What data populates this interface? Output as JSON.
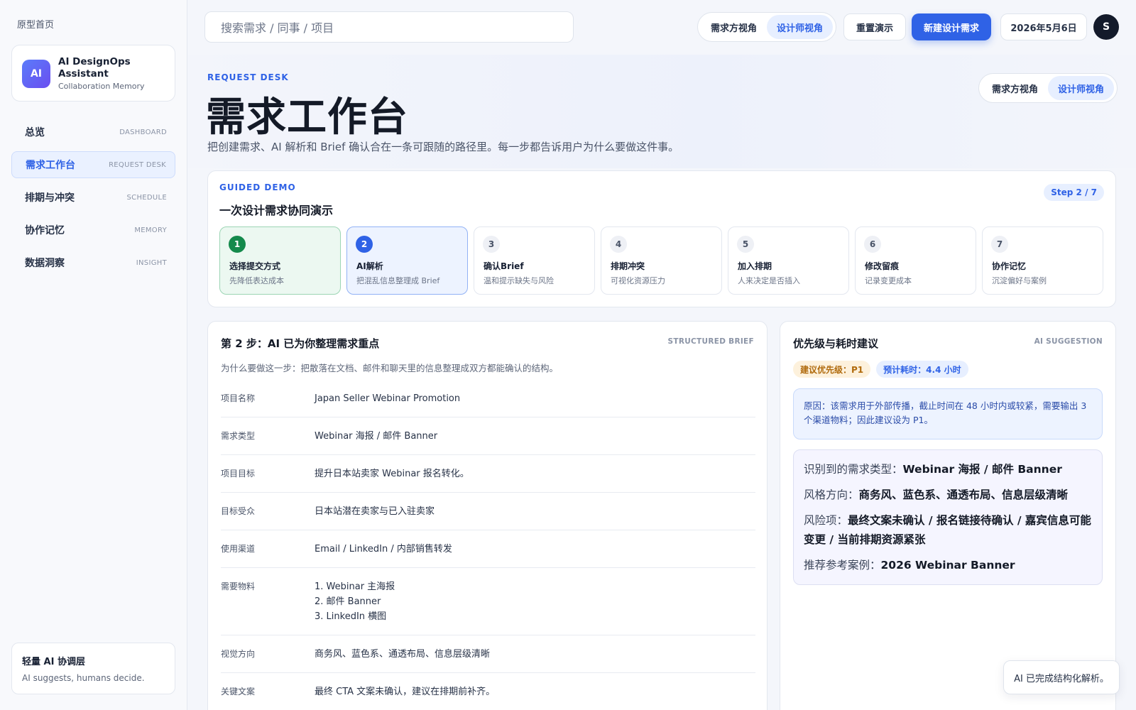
{
  "sidebar": {
    "home_link": "原型首页",
    "brand": {
      "logo": "AI",
      "title": "AI DesignOps Assistant",
      "subtitle": "Collaboration Memory"
    },
    "items": [
      {
        "label": "总览",
        "en": "DASHBOARD"
      },
      {
        "label": "需求工作台",
        "en": "REQUEST DESK"
      },
      {
        "label": "排期与冲突",
        "en": "SCHEDULE"
      },
      {
        "label": "协作记忆",
        "en": "MEMORY"
      },
      {
        "label": "数据洞察",
        "en": "INSIGHT"
      }
    ],
    "footer": {
      "title": "轻量 AI 协调层",
      "subtitle": "AI suggests, humans decide."
    }
  },
  "topbar": {
    "search_placeholder": "搜索需求 / 同事 / 项目",
    "view_toggle": [
      "需求方视角",
      "设计师视角"
    ],
    "reset_label": "重置演示",
    "new_request_label": "新建设计需求",
    "date": "2026年5月6日",
    "avatar": "S"
  },
  "header": {
    "eyebrow": "REQUEST DESK",
    "title": "需求工作台",
    "description": "把创建需求、AI 解析和 Brief 确认合在一条可跟随的路径里。每一步都告诉用户为什么要做这件事。",
    "view_toggle": [
      "需求方视角",
      "设计师视角"
    ]
  },
  "demo": {
    "eyebrow": "GUIDED DEMO",
    "title": "一次设计需求协同演示",
    "step_badge": "Step 2 / 7",
    "steps": [
      {
        "num": "1",
        "title": "选择提交方式",
        "sub": "先降低表达成本"
      },
      {
        "num": "2",
        "title": "AI解析",
        "sub": "把混乱信息整理成 Brief"
      },
      {
        "num": "3",
        "title": "确认Brief",
        "sub": "温和提示缺失与风险"
      },
      {
        "num": "4",
        "title": "排期冲突",
        "sub": "可视化资源压力"
      },
      {
        "num": "5",
        "title": "加入排期",
        "sub": "人来决定是否插入"
      },
      {
        "num": "6",
        "title": "修改留痕",
        "sub": "记录变更成本"
      },
      {
        "num": "7",
        "title": "协作记忆",
        "sub": "沉淀偏好与案例"
      }
    ]
  },
  "brief": {
    "title": "第 2 步：AI 已为你整理需求重点",
    "tag": "STRUCTURED BRIEF",
    "description": "为什么要做这一步：把散落在文档、邮件和聊天里的信息整理成双方都能确认的结构。",
    "fields": [
      {
        "label": "项目名称",
        "value": "Japan Seller Webinar Promotion"
      },
      {
        "label": "需求类型",
        "value": "Webinar 海报 / 邮件 Banner"
      },
      {
        "label": "项目目标",
        "value": "提升日本站卖家 Webinar 报名转化。"
      },
      {
        "label": "目标受众",
        "value": "日本站潜在卖家与已入驻卖家"
      },
      {
        "label": "使用渠道",
        "value": "Email / LinkedIn / 内部销售转发"
      },
      {
        "label": "需要物料",
        "value": "1. Webinar 主海报\n2. 邮件 Banner\n3. LinkedIn 横图"
      },
      {
        "label": "视觉方向",
        "value": "商务风、蓝色系、通透布局、信息层级清晰"
      },
      {
        "label": "关键文案",
        "value": "最终 CTA 文案未确认，建议在排期前补齐。"
      }
    ]
  },
  "suggestion": {
    "title": "优先级与耗时建议",
    "tag": "AI SUGGESTION",
    "priority_chip": "建议优先级：P1",
    "time_chip": "预计耗时：4.4 小时",
    "reason": "原因：该需求用于外部传播，截止时间在 48 小时内或较紧，需要输出 3 个渠道物料；因此建议设为 P1。",
    "insights": [
      {
        "label": "识别到的需求类型：",
        "value": "Webinar 海报 / 邮件 Banner"
      },
      {
        "label": "风格方向：",
        "value": "商务风、蓝色系、通透布局、信息层级清晰"
      },
      {
        "label": "风险项：",
        "value": "最终文案未确认 / 报名链接待确认 / 嘉宾信息可能变更 / 当前排期资源紧张"
      },
      {
        "label": "推荐参考案例：",
        "value": "2026 Webinar Banner"
      }
    ]
  },
  "toast": "AI 已完成结构化解析。"
}
